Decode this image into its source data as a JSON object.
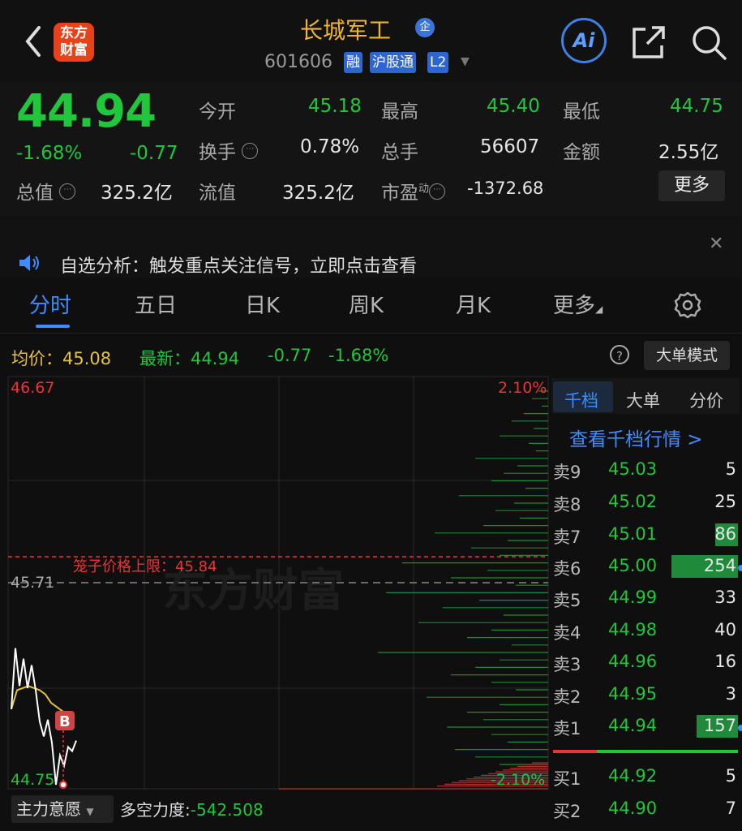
{
  "header": {
    "title": "长城军工",
    "qi_badge": "企",
    "code": "601606",
    "tags": [
      "融",
      "沪股通",
      "L2"
    ],
    "logo_text_1": "东方",
    "logo_text_2": "财富",
    "ai_label": "Ai"
  },
  "quote": {
    "price": "44.94",
    "change_pct": "-1.68%",
    "change": "-0.77",
    "open_label": "今开",
    "open": "45.18",
    "high_label": "最高",
    "high": "45.40",
    "low_label": "最低",
    "low": "44.75",
    "turnover_label": "换手",
    "turnover": "0.78%",
    "volume_label": "总手",
    "volume": "56607",
    "amount_label": "金额",
    "amount": "2.55亿",
    "mktcap_label": "总值",
    "mktcap": "325.2亿",
    "float_label": "流值",
    "float": "325.2亿",
    "pe_label": "市盈",
    "pe_sup": "动",
    "pe": "-1372.68",
    "more": "更多"
  },
  "banner": {
    "text": "自选分析：触发重点关注信号，立即点击查看"
  },
  "tabs": [
    "分时",
    "五日",
    "日K",
    "周K",
    "月K",
    "更多"
  ],
  "info": {
    "avg_label": "均价：",
    "avg": "45.08",
    "latest_label": "最新：",
    "latest": "44.94",
    "change": "-0.77",
    "change_pct": "-1.68%",
    "big_mode": "大单模式"
  },
  "chart_labels": {
    "top_price": "46.67",
    "top_pct": "2.10%",
    "ref_price": "45.71",
    "bottom_price": "44.75",
    "bottom_pct": "-2.10%",
    "cage_label": "笼子价格上限：45.84",
    "buy_marker": "B",
    "watermark": "东方财富"
  },
  "chart_data": {
    "type": "line",
    "y_range": [
      44.75,
      46.67
    ],
    "pct_range": [
      -2.1,
      2.1
    ],
    "reference_price": 45.71,
    "cage_upper_limit": 45.84,
    "series": [
      {
        "name": "最新",
        "color": "#ffffff",
        "values": [
          45.11,
          45.4,
          45.22,
          45.35,
          45.21,
          45.32,
          45.2,
          45.05,
          44.98,
          45.06,
          44.95,
          44.75,
          44.89,
          44.84,
          44.93,
          44.91,
          44.96
        ]
      },
      {
        "name": "均价",
        "color": "#e6c23a",
        "values": [
          45.11,
          45.2,
          45.21,
          45.22,
          45.21,
          45.2,
          45.18,
          45.14,
          45.12,
          45.1,
          45.09,
          45.08
        ]
      }
    ]
  },
  "orderbook": {
    "tabs": [
      "千档",
      "大单",
      "分价"
    ],
    "link": "查看千档行情 >",
    "asks": [
      {
        "label": "卖9",
        "price": "45.03",
        "vol": "5",
        "vol_n": 5
      },
      {
        "label": "卖8",
        "price": "45.02",
        "vol": "25",
        "vol_n": 25
      },
      {
        "label": "卖7",
        "price": "45.01",
        "vol": "86",
        "vol_n": 86
      },
      {
        "label": "卖6",
        "price": "45.00",
        "vol": "254",
        "vol_n": 254
      },
      {
        "label": "卖5",
        "price": "44.99",
        "vol": "33",
        "vol_n": 33
      },
      {
        "label": "卖4",
        "price": "44.98",
        "vol": "40",
        "vol_n": 40
      },
      {
        "label": "卖3",
        "price": "44.96",
        "vol": "16",
        "vol_n": 16
      },
      {
        "label": "卖2",
        "price": "44.95",
        "vol": "3",
        "vol_n": 3
      },
      {
        "label": "卖1",
        "price": "44.94",
        "vol": "157",
        "vol_n": 157
      }
    ],
    "bids": [
      {
        "label": "买1",
        "price": "44.92",
        "vol": "5"
      },
      {
        "label": "买2",
        "price": "44.90",
        "vol": "7"
      }
    ]
  },
  "bottom": {
    "indicator": "主力意愿",
    "force_label": "多空力度:",
    "force": "-542.508"
  }
}
